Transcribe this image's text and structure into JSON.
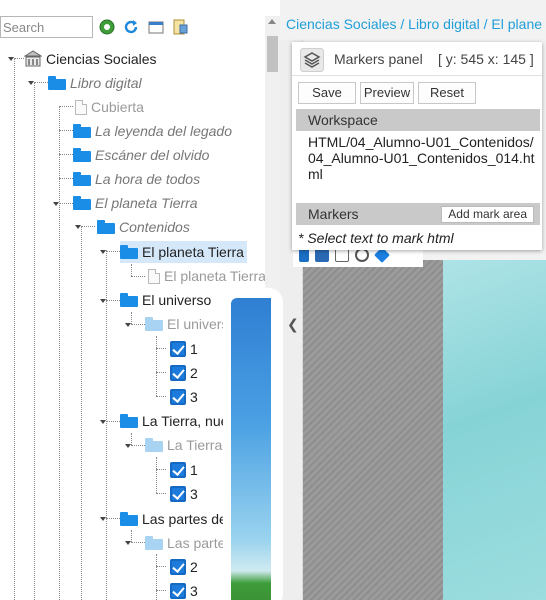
{
  "search": {
    "placeholder": "Search"
  },
  "toolbar": {
    "icons": [
      "globe-icon",
      "refresh-icon",
      "window-icon",
      "document-tool-icon"
    ]
  },
  "tree": {
    "root_label": "Ciencias Sociales",
    "book_label": "Libro digital",
    "cover_label": "Cubierta",
    "ch1_label": "La leyenda del legado",
    "ch2_label": "Escáner del olvido",
    "ch3_label": "La hora de todos",
    "ch4_label": "El planeta Tierra",
    "contents_label": "Contenidos",
    "sel_label": "El planeta Tierra",
    "sel_doc_label": "El planeta Tierra",
    "universe_label": "El universo",
    "universe_sub_label": "El universo",
    "u1": "1",
    "u2": "2",
    "u3": "3",
    "earth_label": "La Tierra, nuestro p",
    "earth_sub_label": "La Tierra, nuest",
    "e1": "1",
    "e3": "3",
    "parts_label": "Las partes de la Tie",
    "parts_sub_label": "Las partes de la",
    "p2": "2",
    "p3": "3"
  },
  "breadcrumb": "Ciencias Sociales / Libro digital / El plane",
  "markers_panel": {
    "title": "Markers panel",
    "coords": "[ y: 545 x: 145 ]",
    "save_label": "Save",
    "preview_label": "Preview",
    "reset_label": "Reset",
    "workspace_label": "Workspace",
    "workspace_path": "HTML/04_Alumno-U01_Contenidos/04_Alumno-U01_Contenidos_014.html",
    "markers_label": "Markers",
    "add_mark_label": "Add mark area",
    "hint": "* Select text to mark html"
  },
  "colors": {
    "accent": "#1a8de6",
    "breadcrumb": "#1f9ed8",
    "selected_bg": "#d5e8fa"
  }
}
